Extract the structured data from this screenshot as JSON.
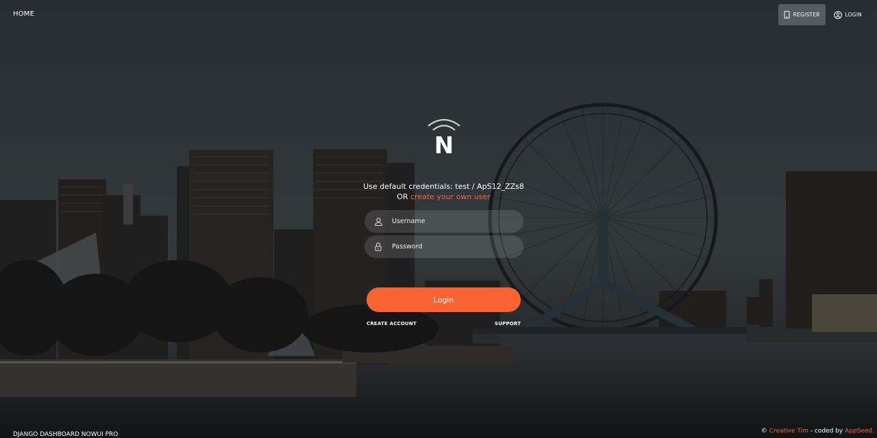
{
  "nav": {
    "home_label": "HOME",
    "register_label": "REGISTER",
    "login_label": "LOGIN"
  },
  "login": {
    "logo_letter": "N",
    "cred_text": "Use default credentials: test / ApS12_ZZs8",
    "or_text": "OR ",
    "create_link": "create your own user",
    "username_placeholder": "Username",
    "password_placeholder": "Password",
    "submit_label": "Login",
    "create_account": "CREATE ACCOUNT",
    "support": "SUPPORT"
  },
  "footer": {
    "product": "DJANGO DASHBOARD NOWUI PRO",
    "copyright": "© ",
    "author1": "Creative Tim",
    "coded_by": " - coded by ",
    "author2": "AppSeed."
  },
  "colors": {
    "accent": "#f96332",
    "field_bg": "rgba(255,255,255,0.12)"
  },
  "icons": [
    "phone-icon",
    "user-circle-icon",
    "user-icon",
    "lock-icon",
    "nowui-logo-icon"
  ]
}
